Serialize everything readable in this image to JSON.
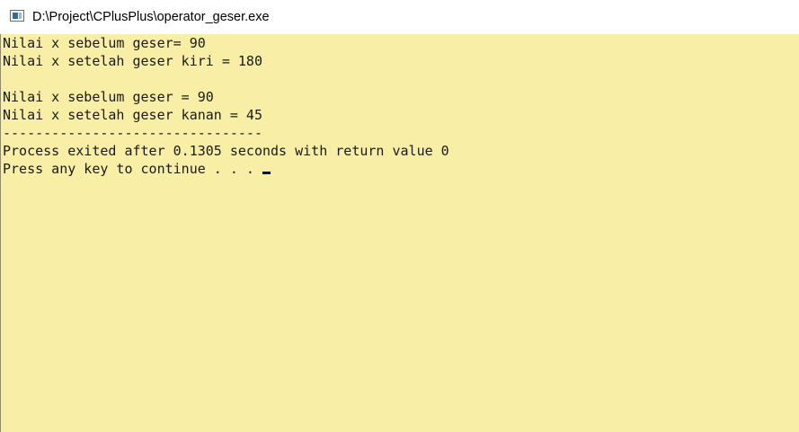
{
  "window": {
    "title": "D:\\Project\\CPlusPlus\\operator_geser.exe",
    "icon": "console-app-icon"
  },
  "console": {
    "background": "#f8eea5",
    "text_color": "#1a1a1a",
    "lines": [
      "Nilai x sebelum geser= 90",
      "Nilai x setelah geser kiri = 180",
      "",
      "Nilai x sebelum geser = 90",
      "Nilai x setelah geser kanan = 45",
      "--------------------------------",
      "Process exited after 0.1305 seconds with return value 0",
      "Press any key to continue . . . "
    ]
  }
}
